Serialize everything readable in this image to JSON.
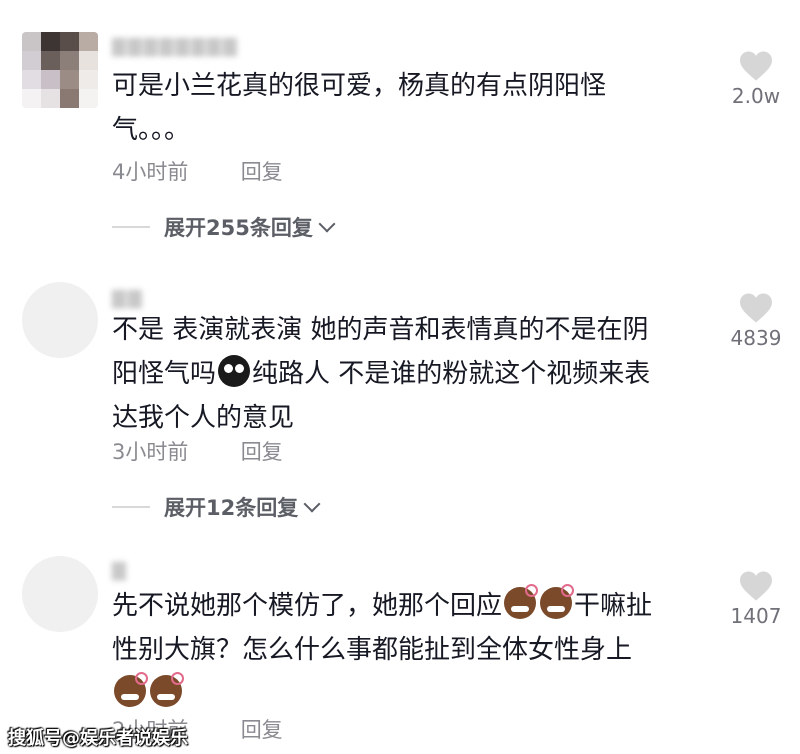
{
  "comments": [
    {
      "text_line1": "可是小兰花真的很可爱，杨真的有点阴阳怪",
      "text_line2": "气。。。",
      "time": "4小时前",
      "reply": "回复",
      "expand": "展开255条回复",
      "likes": "2.0w"
    },
    {
      "text_line1": "不是 表演就表演 她的声音和表情真的不是在阴",
      "text_line2a": "阳怪气吗",
      "text_line2b": "纯路人 不是谁的粉就这个视频来表",
      "text_line3": "达我个人的意见",
      "time": "3小时前",
      "reply": "回复",
      "expand": "展开12条回复",
      "likes": "4839"
    },
    {
      "text_line1a": "先不说她那个模仿了，她那个回应",
      "text_line1b": "干嘛扯",
      "text_line2": "性别大旗？怎么什么事都能扯到全体女性身上",
      "time": "2小时前",
      "reply": "回复",
      "likes": "1407"
    }
  ],
  "icons": {
    "like": "heart-icon",
    "expand": "chevron-down-icon",
    "emoji_sweat": "sweat-face-emoji",
    "emoji_grin": "grin-face-emoji"
  },
  "colors": {
    "text": "#161823",
    "meta": "#8a8b91",
    "heart": "#d6d6d6"
  },
  "watermark": "搜狐号@娱乐者说娱乐"
}
